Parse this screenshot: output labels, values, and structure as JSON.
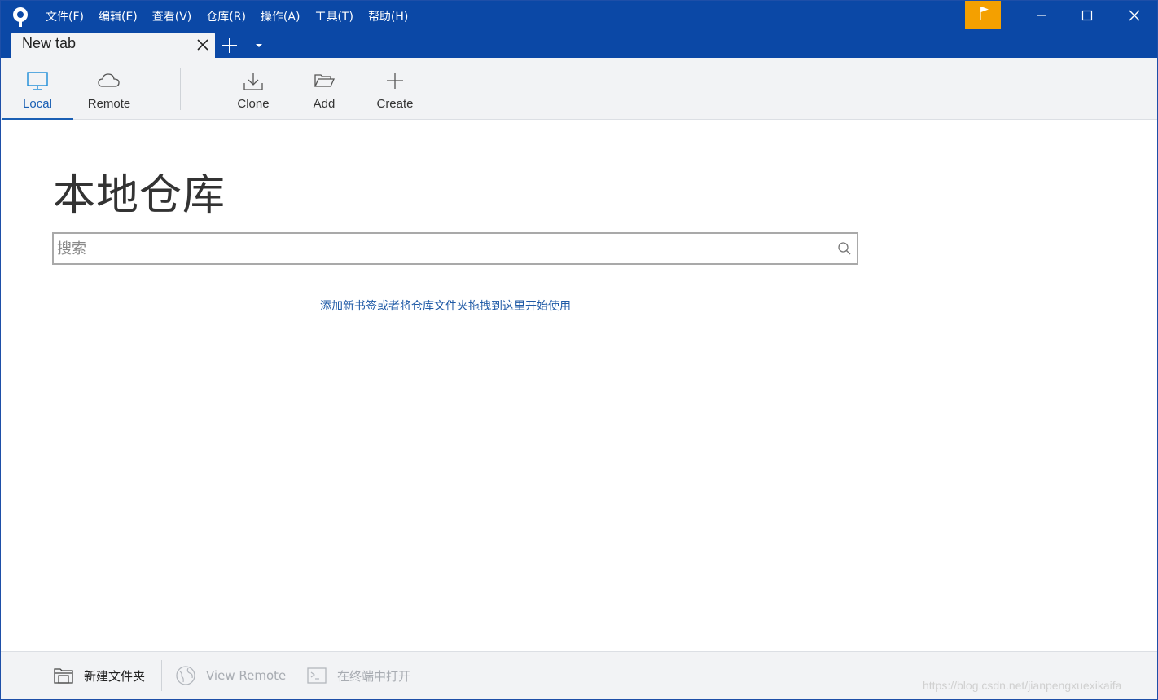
{
  "menu": {
    "items": [
      "文件(F)",
      "编辑(E)",
      "查看(V)",
      "仓库(R)",
      "操作(A)",
      "工具(T)",
      "帮助(H)"
    ]
  },
  "tabs": [
    {
      "label": "New tab"
    }
  ],
  "toolbar": {
    "local_label": "Local",
    "remote_label": "Remote",
    "clone_label": "Clone",
    "add_label": "Add",
    "create_label": "Create",
    "active": "Local"
  },
  "main": {
    "title": "本地仓库",
    "search": {
      "placeholder": "搜索",
      "value": ""
    },
    "hint": "添加新书签或者将仓库文件夹拖拽到这里开始使用"
  },
  "bottom": {
    "new_folder_label": "新建文件夹",
    "view_remote_label": "View Remote",
    "open_terminal_label": "在终端中打开"
  },
  "watermark": "https://blog.csdn.net/jianpengxuexikaifa",
  "colors": {
    "titlebar": "#0b48a6",
    "flag": "#f4a000",
    "accent": "#1a5fb4"
  }
}
